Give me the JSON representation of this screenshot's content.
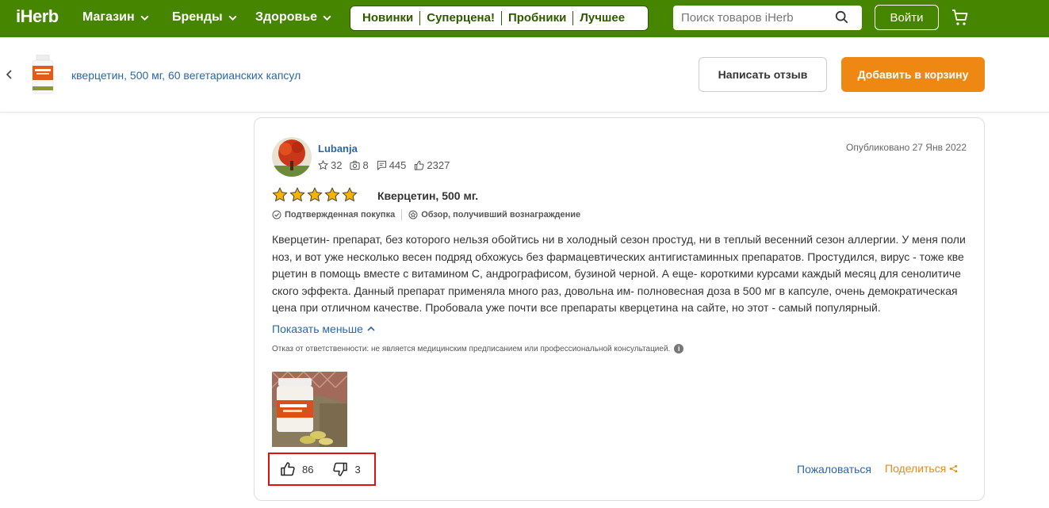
{
  "header": {
    "logo": "iHerb",
    "nav": [
      {
        "label": "Магазин"
      },
      {
        "label": "Бренды"
      },
      {
        "label": "Здоровье"
      }
    ],
    "quick_links": [
      "Новинки",
      "Суперцена!",
      "Пробники",
      "Лучшее"
    ],
    "search_placeholder": "Поиск товаров iHerb",
    "login_label": "Войти"
  },
  "product": {
    "name": "кверцетин, 500 мг, 60 вегетарианских капсул",
    "write_review_label": "Написать отзыв",
    "add_to_cart_label": "Добавить в корзину"
  },
  "review": {
    "author": "Lubanja",
    "stats": {
      "stars": "32",
      "photos": "8",
      "reviews": "445",
      "helpful": "2327"
    },
    "published": "Опубликовано 27 Янв 2022",
    "rating": 5,
    "title": "Кверцетин, 500 мг.",
    "badges": [
      "Подтвержденная покупка",
      "Обзор, получивший вознаграждение"
    ],
    "text_lines": [
      "Кверцетин- препарат, без которого нельзя обойтись ни в холодный сезон простуд, ни в теплый весенний сезон аллергии. У меня поли",
      "ноз, и вот уже несколько весен подряд обхожусь без фармацевтических антигистаминных препаратов. Простудился, вирус - тоже кве",
      "рцетин в помощь вместе с витамином С, андрографисом, бузиной черной. А еще- короткими курсами каждый месяц для сенолитиче",
      "ского эффекта. Данный препарат применяла много раз, довольна им- полновесная доза в 500 мг в капсуле, очень демократическая",
      "цена при отличном качестве. Пробовала уже почти все препараты кверцетина на сайте, но этот - самый популярный."
    ],
    "show_less_label": "Показать меньше",
    "disclaimer": "Отказ от ответственности: не является медицинским предписанием или профессиональной консультацией.",
    "helpful_votes": "86",
    "unhelpful_votes": "3",
    "report_label": "Пожаловаться",
    "share_label": "Поделиться"
  },
  "colors": {
    "brand_green": "#458500",
    "cta_orange": "#ef8812",
    "link_blue": "#2a67a8",
    "star_gold": "#f5b301",
    "highlight_red": "#e01010"
  },
  "icons": [
    "chevron-down-icon",
    "search-icon",
    "cart-icon",
    "back-chevron-icon",
    "star-icon",
    "camera-icon",
    "comment-icon",
    "thumbs-up-icon",
    "thumbs-down-icon",
    "verified-icon",
    "reward-icon",
    "info-icon",
    "share-icon"
  ]
}
